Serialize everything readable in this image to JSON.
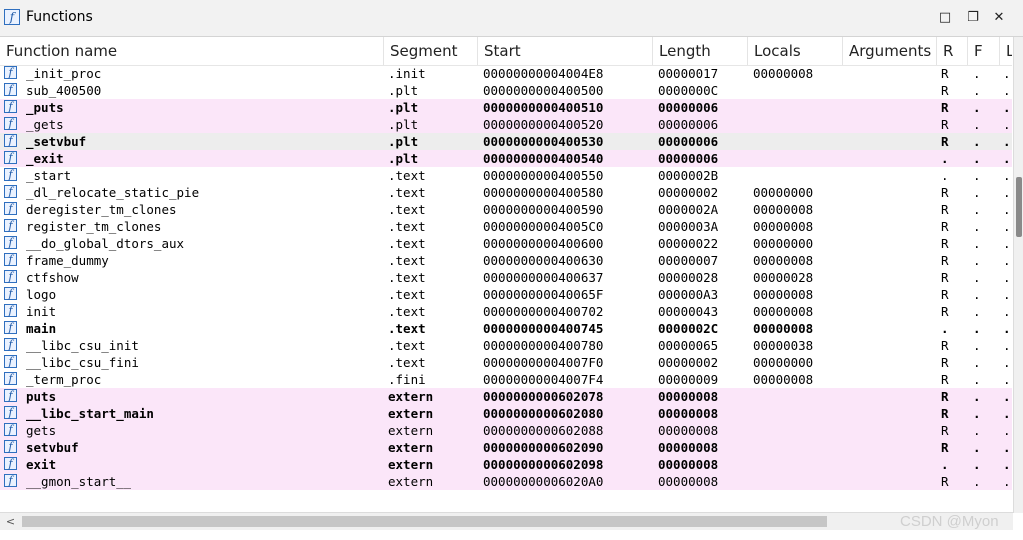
{
  "window": {
    "title": "Functions",
    "icon": "function-icon",
    "controls": [
      "restore-icon",
      "maximize-icon",
      "close-icon"
    ],
    "control_glyphs": [
      "□",
      "❐",
      "✕"
    ]
  },
  "columns": [
    "Function name",
    "Segment",
    "Start",
    "Length",
    "Locals",
    "Arguments",
    "R",
    "F",
    "L"
  ],
  "colors": {
    "highlight_row": "#fbe6f9",
    "selected_row": "#ededed",
    "icon_blue": "#1e5aa8"
  },
  "rows": [
    {
      "name": "_init_proc",
      "segment": ".init",
      "start": "00000000004004E8",
      "length": "00000017",
      "locals": "00000008",
      "args": "",
      "r": "R",
      "f": ".",
      "l": ".",
      "style": "normal"
    },
    {
      "name": "sub_400500",
      "segment": ".plt",
      "start": "0000000000400500",
      "length": "0000000C",
      "locals": "",
      "args": "",
      "r": "R",
      "f": ".",
      "l": ".",
      "style": "normal"
    },
    {
      "name": "_puts",
      "segment": ".plt",
      "start": "0000000000400510",
      "length": "00000006",
      "locals": "",
      "args": "",
      "r": "R",
      "f": ".",
      "l": ".",
      "style": "pink-bold"
    },
    {
      "name": "_gets",
      "segment": ".plt",
      "start": "0000000000400520",
      "length": "00000006",
      "locals": "",
      "args": "",
      "r": "R",
      "f": ".",
      "l": ".",
      "style": "pink"
    },
    {
      "name": "_setvbuf",
      "segment": ".plt",
      "start": "0000000000400530",
      "length": "00000006",
      "locals": "",
      "args": "",
      "r": "R",
      "f": ".",
      "l": ".",
      "style": "selected-bold"
    },
    {
      "name": "_exit",
      "segment": ".plt",
      "start": "0000000000400540",
      "length": "00000006",
      "locals": "",
      "args": "",
      "r": ".",
      "f": ".",
      "l": ".",
      "style": "pink-bold"
    },
    {
      "name": "_start",
      "segment": ".text",
      "start": "0000000000400550",
      "length": "0000002B",
      "locals": "",
      "args": "",
      "r": ".",
      "f": ".",
      "l": ".",
      "style": "normal"
    },
    {
      "name": "_dl_relocate_static_pie",
      "segment": ".text",
      "start": "0000000000400580",
      "length": "00000002",
      "locals": "00000000",
      "args": "",
      "r": "R",
      "f": ".",
      "l": ".",
      "style": "normal"
    },
    {
      "name": "deregister_tm_clones",
      "segment": ".text",
      "start": "0000000000400590",
      "length": "0000002A",
      "locals": "00000008",
      "args": "",
      "r": "R",
      "f": ".",
      "l": ".",
      "style": "normal"
    },
    {
      "name": "register_tm_clones",
      "segment": ".text",
      "start": "00000000004005C0",
      "length": "0000003A",
      "locals": "00000008",
      "args": "",
      "r": "R",
      "f": ".",
      "l": ".",
      "style": "normal"
    },
    {
      "name": "__do_global_dtors_aux",
      "segment": ".text",
      "start": "0000000000400600",
      "length": "00000022",
      "locals": "00000000",
      "args": "",
      "r": "R",
      "f": ".",
      "l": ".",
      "style": "normal"
    },
    {
      "name": "frame_dummy",
      "segment": ".text",
      "start": "0000000000400630",
      "length": "00000007",
      "locals": "00000008",
      "args": "",
      "r": "R",
      "f": ".",
      "l": ".",
      "style": "normal"
    },
    {
      "name": "ctfshow",
      "segment": ".text",
      "start": "0000000000400637",
      "length": "00000028",
      "locals": "00000028",
      "args": "",
      "r": "R",
      "f": ".",
      "l": ".",
      "style": "normal"
    },
    {
      "name": "logo",
      "segment": ".text",
      "start": "000000000040065F",
      "length": "000000A3",
      "locals": "00000008",
      "args": "",
      "r": "R",
      "f": ".",
      "l": ".",
      "style": "normal"
    },
    {
      "name": "init",
      "segment": ".text",
      "start": "0000000000400702",
      "length": "00000043",
      "locals": "00000008",
      "args": "",
      "r": "R",
      "f": ".",
      "l": ".",
      "style": "normal"
    },
    {
      "name": "main",
      "segment": ".text",
      "start": "0000000000400745",
      "length": "0000002C",
      "locals": "00000008",
      "args": "",
      "r": ".",
      "f": ".",
      "l": ".",
      "style": "bold"
    },
    {
      "name": "__libc_csu_init",
      "segment": ".text",
      "start": "0000000000400780",
      "length": "00000065",
      "locals": "00000038",
      "args": "",
      "r": "R",
      "f": ".",
      "l": ".",
      "style": "normal"
    },
    {
      "name": "__libc_csu_fini",
      "segment": ".text",
      "start": "00000000004007F0",
      "length": "00000002",
      "locals": "00000000",
      "args": "",
      "r": "R",
      "f": ".",
      "l": ".",
      "style": "normal"
    },
    {
      "name": "_term_proc",
      "segment": ".fini",
      "start": "00000000004007F4",
      "length": "00000009",
      "locals": "00000008",
      "args": "",
      "r": "R",
      "f": ".",
      "l": ".",
      "style": "normal"
    },
    {
      "name": "puts",
      "segment": "extern",
      "start": "0000000000602078",
      "length": "00000008",
      "locals": "",
      "args": "",
      "r": "R",
      "f": ".",
      "l": ".",
      "style": "pink-bold"
    },
    {
      "name": "__libc_start_main",
      "segment": "extern",
      "start": "0000000000602080",
      "length": "00000008",
      "locals": "",
      "args": "",
      "r": "R",
      "f": ".",
      "l": ".",
      "style": "pink-bold"
    },
    {
      "name": "gets",
      "segment": "extern",
      "start": "0000000000602088",
      "length": "00000008",
      "locals": "",
      "args": "",
      "r": "R",
      "f": ".",
      "l": ".",
      "style": "pink"
    },
    {
      "name": "setvbuf",
      "segment": "extern",
      "start": "0000000000602090",
      "length": "00000008",
      "locals": "",
      "args": "",
      "r": "R",
      "f": ".",
      "l": ".",
      "style": "pink-bold"
    },
    {
      "name": "exit",
      "segment": "extern",
      "start": "0000000000602098",
      "length": "00000008",
      "locals": "",
      "args": "",
      "r": ".",
      "f": ".",
      "l": ".",
      "style": "pink-bold"
    },
    {
      "name": "__gmon_start__",
      "segment": "extern",
      "start": "00000000006020A0",
      "length": "00000008",
      "locals": "",
      "args": "",
      "r": "R",
      "f": ".",
      "l": ".",
      "style": "pink"
    }
  ],
  "scroll": {
    "left_arrow": "<",
    "right_arrow": ">"
  },
  "watermark": "CSDN @Myon"
}
